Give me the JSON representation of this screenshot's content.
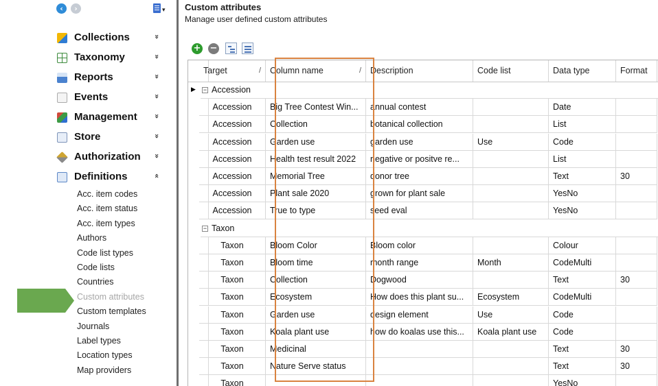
{
  "nav": {
    "sections": [
      {
        "label": "Collections",
        "icon": "collections-icon",
        "name": "nav-section-collections",
        "chevron": "»"
      },
      {
        "label": "Taxonomy",
        "icon": "taxonomy-icon",
        "name": "nav-section-taxonomy",
        "chevron": "»"
      },
      {
        "label": "Reports",
        "icon": "reports-icon",
        "name": "nav-section-reports",
        "chevron": "»"
      },
      {
        "label": "Events",
        "icon": "events-icon",
        "name": "nav-section-events",
        "chevron": "»"
      },
      {
        "label": "Management",
        "icon": "management-icon",
        "name": "nav-section-management",
        "chevron": "»"
      },
      {
        "label": "Store",
        "icon": "store-icon",
        "name": "nav-section-store",
        "chevron": "»"
      },
      {
        "label": "Authorization",
        "icon": "authorization-icon",
        "name": "nav-section-authorization",
        "chevron": "»"
      },
      {
        "label": "Definitions",
        "icon": "definitions-icon",
        "name": "nav-section-definitions",
        "chevron": "«"
      }
    ],
    "definitions_items": [
      "Acc. item codes",
      "Acc. item status",
      "Acc. item types",
      "Authors",
      "Code list types",
      "Code lists",
      "Countries",
      "Custom attributes",
      "Custom templates",
      "Journals",
      "Label types",
      "Location types",
      "Map providers"
    ],
    "selected_item": "Custom attributes"
  },
  "page": {
    "title": "Custom attributes",
    "subtitle": "Manage user defined custom attributes"
  },
  "grid": {
    "columns": [
      "Target",
      "Column name",
      "Description",
      "Code list",
      "Data type",
      "Format"
    ],
    "sort_marks": [
      "/",
      "/"
    ],
    "groups": [
      {
        "label": "Accession",
        "rows": [
          [
            "Accession",
            "Big Tree Contest Win...",
            "annual contest",
            "",
            "Date",
            ""
          ],
          [
            "Accession",
            "Collection",
            "botanical collection",
            "",
            "List",
            ""
          ],
          [
            "Accession",
            "Garden use",
            "garden use",
            "Use",
            "Code",
            ""
          ],
          [
            "Accession",
            "Health test result 2022",
            "negative or positve re...",
            "",
            "List",
            ""
          ],
          [
            "Accession",
            "Memorial Tree",
            "donor tree",
            "",
            "Text",
            "30"
          ],
          [
            "Accession",
            "Plant sale 2020",
            "grown for plant sale",
            "",
            "YesNo",
            ""
          ],
          [
            "Accession",
            "True to type",
            "seed eval",
            "",
            "YesNo",
            ""
          ]
        ]
      },
      {
        "label": "Taxon",
        "rows": [
          [
            "Taxon",
            "Bloom Color",
            "Bloom color",
            "",
            "Colour",
            ""
          ],
          [
            "Taxon",
            "Bloom time",
            "month range",
            "Month",
            "CodeMulti",
            ""
          ],
          [
            "Taxon",
            "Collection",
            "Dogwood",
            "",
            "Text",
            "30"
          ],
          [
            "Taxon",
            "Ecosystem",
            "How does this plant su...",
            "Ecosystem",
            "CodeMulti",
            ""
          ],
          [
            "Taxon",
            "Garden use",
            "design element",
            "Use",
            "Code",
            ""
          ],
          [
            "Taxon",
            "Koala plant use",
            "how do koalas use this...",
            "Koala plant use",
            "Code",
            ""
          ],
          [
            "Taxon",
            "Medicinal",
            "",
            "",
            "Text",
            "30"
          ],
          [
            "Taxon",
            "Nature Serve status",
            "",
            "",
            "Text",
            "30"
          ],
          [
            "Taxon",
            "",
            "",
            "",
            "YesNo",
            ""
          ]
        ]
      }
    ]
  },
  "colors": {
    "highlight": "#d9823f",
    "pointer": "#6aa84f",
    "selected_text": "#a7a7a7"
  }
}
